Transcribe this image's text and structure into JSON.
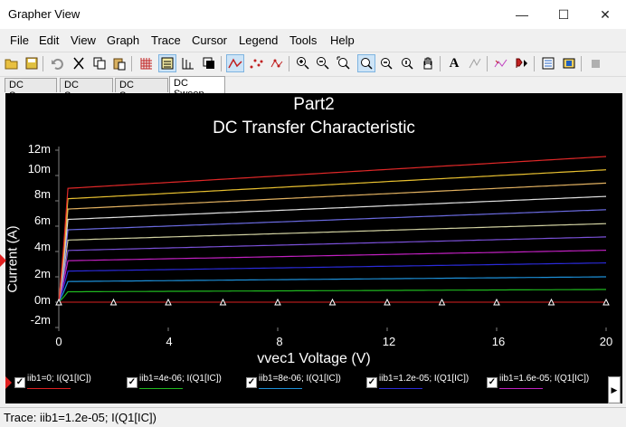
{
  "window": {
    "title": "Grapher View",
    "minimize": "—",
    "maximize": "☐",
    "close": "✕"
  },
  "menu": [
    "File",
    "Edit",
    "View",
    "Graph",
    "Trace",
    "Cursor",
    "Legend",
    "Tools",
    "Help"
  ],
  "tabs": [
    "DC Sweep",
    "DC Sweep",
    "DC Sweep",
    "DC Sweep"
  ],
  "active_tab": 3,
  "status": {
    "text": "Trace: iib1=1.2e-05; I(Q1[IC])"
  },
  "chart_data": {
    "type": "line",
    "title": "Part2",
    "subtitle": "DC Transfer Characteristic",
    "xlabel": "vvec1 Voltage (V)",
    "ylabel": "Current (A)",
    "xlim": [
      0,
      20
    ],
    "ylim": [
      -2,
      12
    ],
    "xticks": [
      "0",
      "4",
      "8",
      "12",
      "16",
      "20"
    ],
    "yticks": [
      "12m",
      "10m",
      "8m",
      "6m",
      "4m",
      "2m",
      "0m",
      "-2m"
    ],
    "grid": true,
    "legend": "bottom",
    "series": [
      {
        "name": "iib1=0; I(Q1[IC])",
        "color": "#dc2020",
        "knee": 0.0,
        "sat": 0.0,
        "end": 0.0,
        "markers": true
      },
      {
        "name": "iib1=4e-06; I(Q1[IC])",
        "color": "#1fb81f",
        "knee": 0.3,
        "sat": 0.82,
        "end": 1.0
      },
      {
        "name": "iib1=8e-06; I(Q1[IC])",
        "color": "#1c8fd8",
        "knee": 0.3,
        "sat": 1.63,
        "end": 2.0
      },
      {
        "name": "iib1=1.2e-05; I(Q1[IC])",
        "color": "#2a2ad8",
        "knee": 0.3,
        "sat": 2.45,
        "end": 3.1
      },
      {
        "name": "iib1=1.6e-05; I(Q1[IC])",
        "color": "#c020c0",
        "knee": 0.3,
        "sat": 3.27,
        "end": 4.1
      },
      {
        "name": "",
        "color": "#7a50d8",
        "knee": 0.3,
        "sat": 4.08,
        "end": 5.15
      },
      {
        "name": "",
        "color": "#d0d0a0",
        "knee": 0.3,
        "sat": 4.9,
        "end": 6.2
      },
      {
        "name": "",
        "color": "#6a6ae0",
        "knee": 0.3,
        "sat": 5.71,
        "end": 7.3
      },
      {
        "name": "",
        "color": "#e0e0e0",
        "knee": 0.3,
        "sat": 6.53,
        "end": 8.35
      },
      {
        "name": "",
        "color": "#e0b060",
        "knee": 0.3,
        "sat": 7.35,
        "end": 9.4
      },
      {
        "name": "",
        "color": "#e8c030",
        "knee": 0.3,
        "sat": 8.16,
        "end": 10.45
      },
      {
        "name": "",
        "color": "#e02828",
        "knee": 0.3,
        "sat": 8.98,
        "end": 11.5
      }
    ],
    "marker_x": [
      0,
      2,
      4,
      6,
      8,
      10,
      12,
      14,
      16,
      18,
      20
    ]
  }
}
